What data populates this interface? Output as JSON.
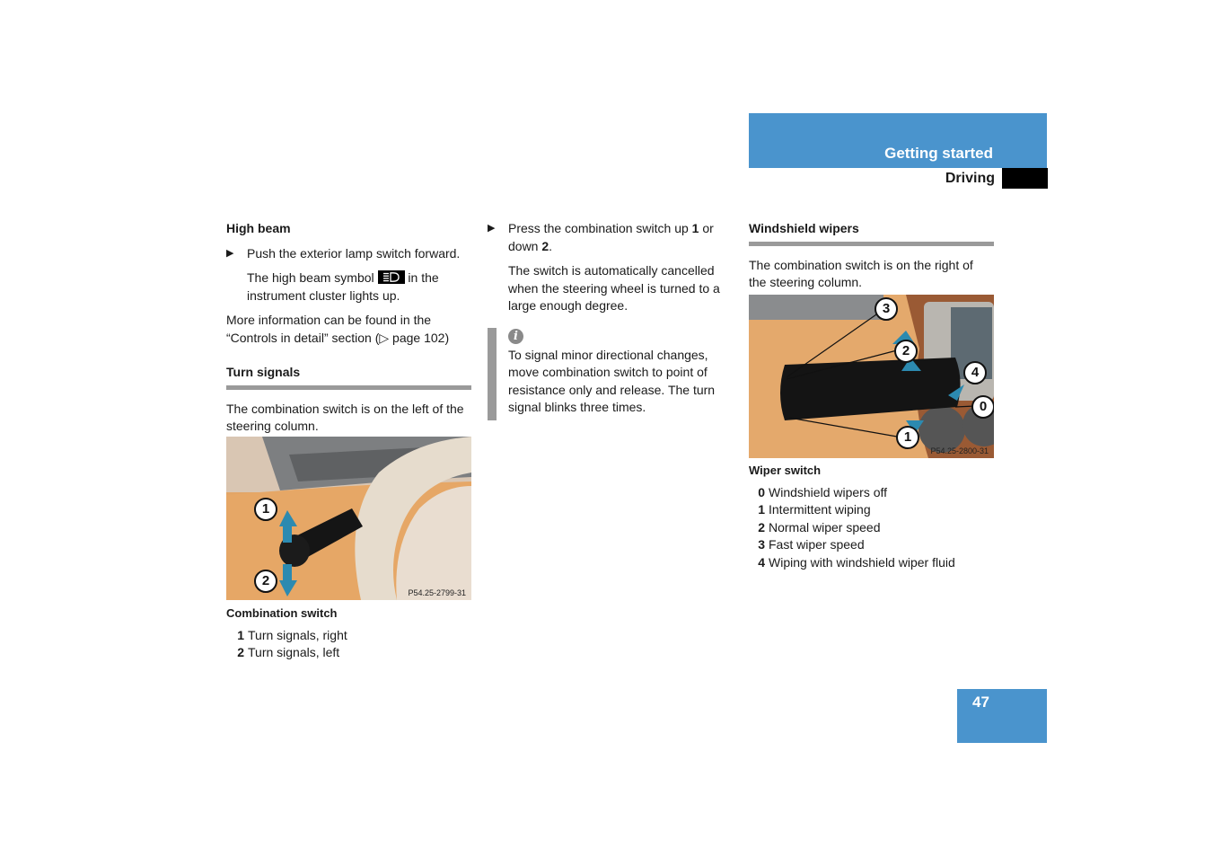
{
  "header": {
    "section": "Getting started",
    "subsection": "Driving",
    "page_number": "47",
    "accent_color": "#4a94cd"
  },
  "left_column": {
    "high_beam": {
      "heading": "High beam",
      "step": "Push the exterior lamp switch forward.",
      "result_pre": "The high beam symbol",
      "result_post": "in the instrument cluster lights up.",
      "symbol_icon": "high-beam-icon",
      "more_info": "More information can be found in the “Controls in detail” section (▷ page 102)"
    },
    "turn_signals": {
      "heading": "Turn signals",
      "intro": "The combination switch is on the left of the steering column.",
      "image_code": "P54.25-2799-31",
      "image_callouts": [
        "1",
        "2"
      ],
      "caption": "Combination switch",
      "legend": [
        {
          "num": "1",
          "text": "Turn signals, right"
        },
        {
          "num": "2",
          "text": "Turn signals, left"
        }
      ]
    }
  },
  "middle_column": {
    "step_pre": "Press the combination switch up",
    "step_num1": "1",
    "step_mid": "or down",
    "step_num2": "2",
    "step_post": ".",
    "note": "The switch is automatically cancelled when the steering wheel is turned to a large enough degree.",
    "info_icon": "i",
    "info_text": "To signal minor directional changes, move combination switch to point of resistance only and release. The turn signal blinks three times."
  },
  "right_column": {
    "heading": "Windshield wipers",
    "intro": "The combination switch is on the right of the steering column.",
    "image_code": "P54.25-2800-31",
    "image_callouts": [
      "3",
      "2",
      "4",
      "0",
      "1"
    ],
    "caption": "Wiper switch",
    "legend": [
      {
        "num": "0",
        "text": "Windshield wipers off"
      },
      {
        "num": "1",
        "text": "Intermittent wiping"
      },
      {
        "num": "2",
        "text": "Normal wiper speed"
      },
      {
        "num": "3",
        "text": "Fast wiper speed"
      },
      {
        "num": "4",
        "text": "Wiping with windshield wiper fluid"
      }
    ]
  }
}
